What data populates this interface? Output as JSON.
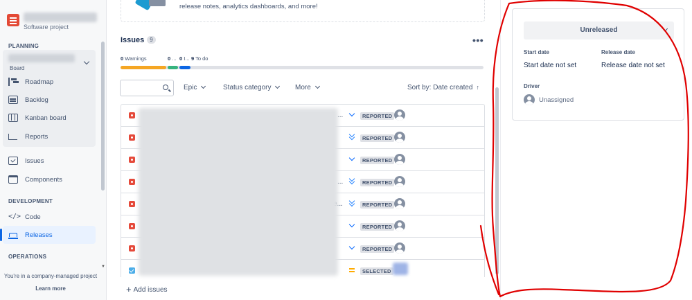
{
  "sidebar": {
    "project_type": "Software project",
    "planning_heading": "PLANNING",
    "board_label": "Board",
    "planning_items": [
      {
        "label": "Roadmap",
        "icon": "roadmap-icon"
      },
      {
        "label": "Backlog",
        "icon": "backlog-icon"
      },
      {
        "label": "Kanban board",
        "icon": "kanban-board-icon"
      },
      {
        "label": "Reports",
        "icon": "reports-icon"
      }
    ],
    "other_items": [
      {
        "label": "Issues",
        "icon": "issues-icon"
      },
      {
        "label": "Components",
        "icon": "components-icon"
      }
    ],
    "development_heading": "DEVELOPMENT",
    "development_items": [
      {
        "label": "Code",
        "icon": "code-icon"
      },
      {
        "label": "Releases",
        "icon": "releases-icon",
        "active": true
      }
    ],
    "operations_heading": "OPERATIONS",
    "footer_text": "You're in a company-managed project",
    "footer_link": "Learn more"
  },
  "banner": {
    "text": "release notes, analytics dashboards, and more!"
  },
  "issues": {
    "title": "Issues",
    "count": "9",
    "more_label": "•••",
    "progress": {
      "warnings_count": "0",
      "warnings_label": "Warnings",
      "done_count": "0",
      "done_label": "...",
      "inprogress_count": "0",
      "inprogress_label": "I...",
      "todo_count": "9",
      "todo_label": "To do",
      "colors": {
        "warnings": "#f5a623",
        "done": "#36b37e",
        "inprogress": "#0c66e4",
        "todo": "#dfe1e6"
      }
    },
    "filters": {
      "epic": "Epic",
      "status_category": "Status category",
      "more": "More",
      "sort": "Sort by: Date created",
      "sort_arrow": "↑"
    },
    "rows": [
      {
        "type": "bug",
        "ellipsis": "...",
        "priority": "low",
        "status": "REPORTED"
      },
      {
        "type": "bug",
        "ellipsis": "",
        "priority": "lowest",
        "status": "REPORTED"
      },
      {
        "type": "bug",
        "ellipsis": "",
        "priority": "low",
        "status": "REPORTED"
      },
      {
        "type": "bug",
        "ellipsis": "...",
        "priority": "lowest",
        "status": "REPORTED"
      },
      {
        "type": "bug",
        "ellipsis": "e...",
        "priority": "lowest",
        "status": "REPORTED"
      },
      {
        "type": "bug",
        "ellipsis": "",
        "priority": "low",
        "status": "REPORTED"
      },
      {
        "type": "bug",
        "ellipsis": "",
        "priority": "low",
        "status": "REPORTED"
      },
      {
        "type": "task",
        "ellipsis": "",
        "priority": "medium",
        "status": "SELECTED"
      }
    ],
    "add_label": "Add issues"
  },
  "release_panel": {
    "status_button": "Unreleased",
    "start_date_label": "Start date",
    "start_date_value": "Start date not set",
    "release_date_label": "Release date",
    "release_date_value": "Release date not set",
    "driver_label": "Driver",
    "driver_value": "Unassigned"
  },
  "colors": {
    "accent": "#0c66e4",
    "bug": "#e5493a",
    "annotation": "#e00000"
  }
}
